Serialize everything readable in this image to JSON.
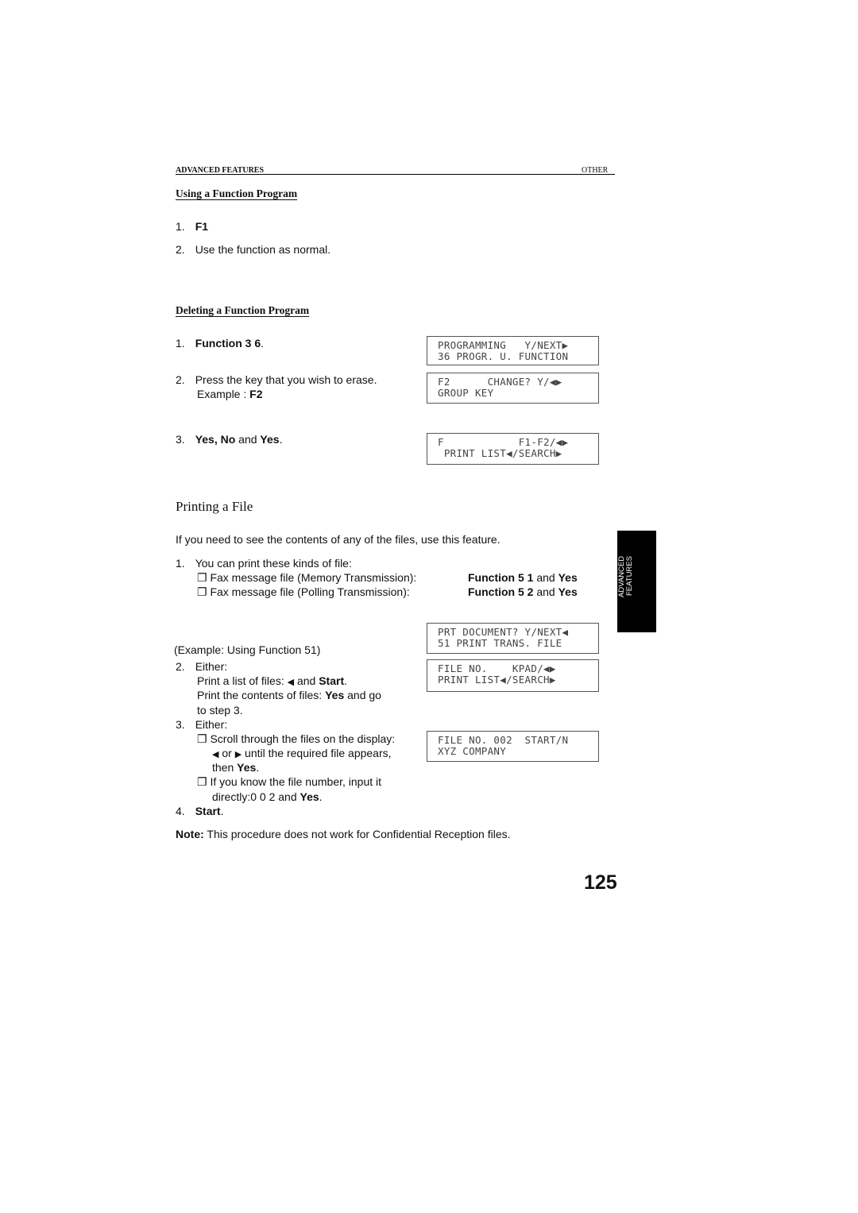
{
  "header": {
    "left": "ADVANCED FEATURES",
    "right": "OTHER"
  },
  "using": {
    "title": "Using a Function Program",
    "s1_num": "1.",
    "s1": "F1",
    "s2_num": "2.",
    "s2": "Use the function as normal."
  },
  "deleting": {
    "title": "Deleting a Function Program",
    "s1_num": "1.",
    "s1_b": "Function 3 6",
    "s1_end": ".",
    "s2_num": "2.",
    "s2": "Press the key that you wish to erase.",
    "s2b_pre": "Example : ",
    "s2b_b": "F2",
    "s3_num": "3.",
    "s3_b1": "Yes, No",
    "s3_m": " and ",
    "s3_b2": "Yes",
    "s3_end": "."
  },
  "lcd": [
    {
      "l1": "PROGRAMMING   Y/NEXT▶",
      "l2": "36 PROGR. U. FUNCTION"
    },
    {
      "l1": "F2      CHANGE? Y/◀▶",
      "l2": "GROUP KEY"
    },
    {
      "l1": "F            F1-F2/◀▶",
      "l2": " PRINT LIST◀/SEARCH▶"
    },
    {
      "l1": "PRT DOCUMENT? Y/NEXT◀",
      "l2": "51 PRINT TRANS. FILE"
    },
    {
      "l1": "FILE NO.    KPAD/◀▶",
      "l2": "PRINT LIST◀/SEARCH▶"
    },
    {
      "l1": "FILE NO. 002  START/N",
      "l2": "XYZ COMPANY"
    }
  ],
  "printing": {
    "title": "Printing a File",
    "intro": "If you need to see the contents of any of the files, use this feature.",
    "s1_num": "1.",
    "s1": "You can print these kinds of file:",
    "bullet": "❐",
    "f1": "Fax message file (Memory Transmission):",
    "f1_b": "Function 5 1",
    "f1_m": " and ",
    "f1_b2": "Yes",
    "f2": "Fax message file (Polling Transmission):",
    "f2_b": "Function 5 2",
    "f2_m": " and ",
    "f2_b2": "Yes",
    "example": "(Example: Using Function 51)",
    "s2_num": "2.",
    "s2": "Either:",
    "s2a_pre": "Print a list of files: ",
    "s2a_arrow": "◀",
    "s2a_m": " and ",
    "s2a_b": "Start",
    "s2a_end": ".",
    "s2b_pre": "Print the contents of files: ",
    "s2b_b": "Yes",
    "s2b_end": " and go",
    "s2c": "to step 3.",
    "s3_num": "3.",
    "s3": "Either:",
    "s3a": "Scroll through the files on the display:",
    "s3b_l": "◀",
    "s3b_m": " or ",
    "s3b_r": "▶",
    "s3b_end": " until the required file appears,",
    "s3c_pre": "then ",
    "s3c_b": "Yes",
    "s3c_end": ".",
    "s3d": "If you know the file number, input it",
    "s3e_pre": "directly:0 0 2 and ",
    "s3e_b": "Yes",
    "s3e_end": ".",
    "s4_num": "4.",
    "s4_b": "Start",
    "s4_end": ".",
    "note_b": "Note:",
    "note": "  This procedure does not work for Confidential Reception files."
  },
  "tab": {
    "label": "ADVANCED FEATURES"
  },
  "page_number": "125"
}
